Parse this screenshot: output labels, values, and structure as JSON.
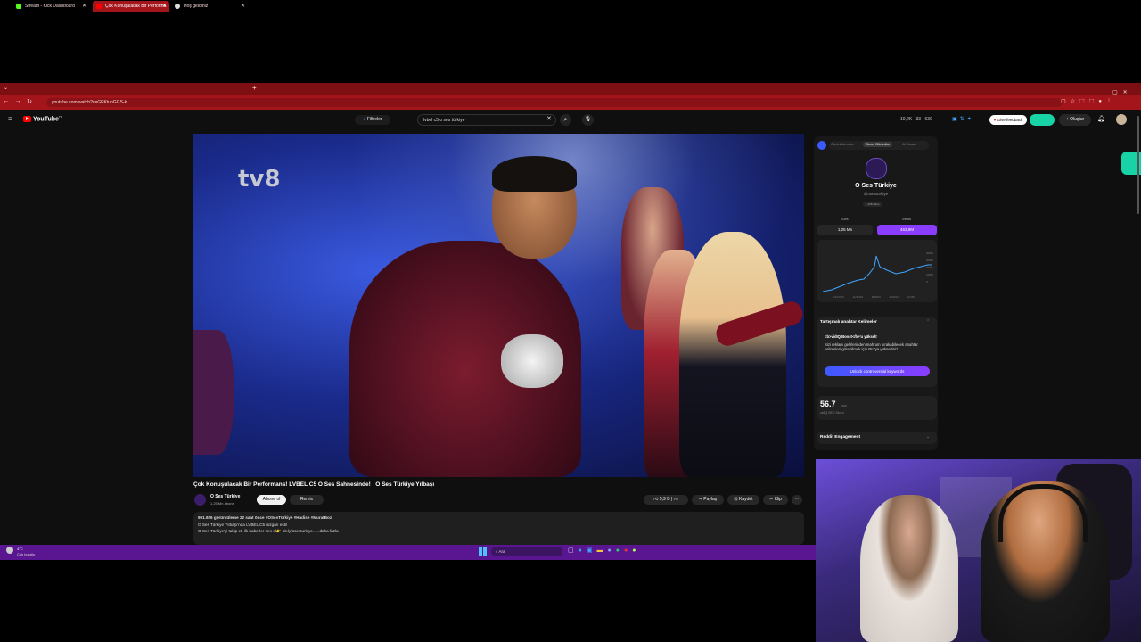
{
  "browser": {
    "tabs": [
      {
        "label": "Stream - Kick Dashboard",
        "active": false,
        "favicon_color": "#53fc18"
      },
      {
        "label": "Çok Konuşulacak Bir Performa",
        "active": true,
        "favicon_color": "#ff0000"
      },
      {
        "label": "Hoş geldiniz",
        "active": false,
        "favicon_color": "#dddddd"
      }
    ],
    "new_tab": "+",
    "url": "youtube.com/watch?v=GPKtuhGGS-k"
  },
  "youtube": {
    "logo_text": "YouTube",
    "logo_superscript": "TR",
    "filters_label": "Filtreler",
    "search_value": "lvbel c5 o ses türkiye",
    "header_stats": "10,2K · 33 · 639",
    "give_feedback": "Give feedback",
    "create_label": "Oluştur",
    "video": {
      "channel_watermark": "tv8",
      "title": "Çok Konuşulacak Bir Performans! LVBEL C5 O Ses Sahnesinde! | O Ses Türkiye Yılbaşı",
      "channel_name": "O Ses Türkiye",
      "subscribers": "1,25 Mn abone",
      "subscribe_label": "Abone ol",
      "remix_label": "Remix",
      "likes": "5,9 B",
      "share_label": "Paylaş",
      "save_label": "Kaydet",
      "clip_label": "Klip",
      "views_line": "991.926 görüntüleme  22 saat önce  #OSesTürkiye #Hadise #MuratBoz",
      "desc_line1": "O Ses Türkiye Yılbaşı'nda LVBEL C5 rüzgârı esti!",
      "desc_line2": "O Ses Türkiye'yi takip et, ilk haberler sen ol👉 bit.ly/osesturkiye..  ...daha fazla"
    },
    "panel": {
      "tabs": [
        "Görüntülemeler",
        "Genel Görünüm",
        "AI Coach"
      ],
      "channel_name": "O Ses Türkiye",
      "channel_handle": "@osesturkiye",
      "channel_badge": "1,198 video",
      "subs_label": "Subs",
      "subs_value": "1,25 Mn",
      "views_label": "Views",
      "views_value": "463,9M",
      "chart_x_labels": [
        "0",
        "12/27/23",
        "11/12/23",
        "8/19/23",
        "4/22/24",
        "1/1/25"
      ],
      "chart_y_labels": [
        "400M",
        "300M",
        "200M",
        "100M",
        "0"
      ],
      "controversial_title": "Tartışmalı anahtar Kelimeler",
      "controversial_badge": "<b>vidIQ Boost</b>'u yükselt",
      "controversial_text": "Sizi reklam gelirlerinden mahrum bırakabilecek anahtar kelimeleri görebilmek için Pro'ya yükseltiniz",
      "unlock_label": "Unlock controversial keywords",
      "seo_score": "56.7",
      "seo_score_suffix": "/100",
      "seo_label": "vidIQ SEO Skoru",
      "reddit_label": "Reddit Engagement"
    }
  },
  "taskbar": {
    "weather_temp": "4°C",
    "weather_text": "Çok bulutlu",
    "search_label": "Ara"
  },
  "colors": {
    "browser_red": "#a3151b",
    "youtube_bg": "#0f0f0f",
    "vidiq_purple": "#8b3dff",
    "unlock_blue": "#3d5afe",
    "taskbar_purple": "#5a1690"
  }
}
